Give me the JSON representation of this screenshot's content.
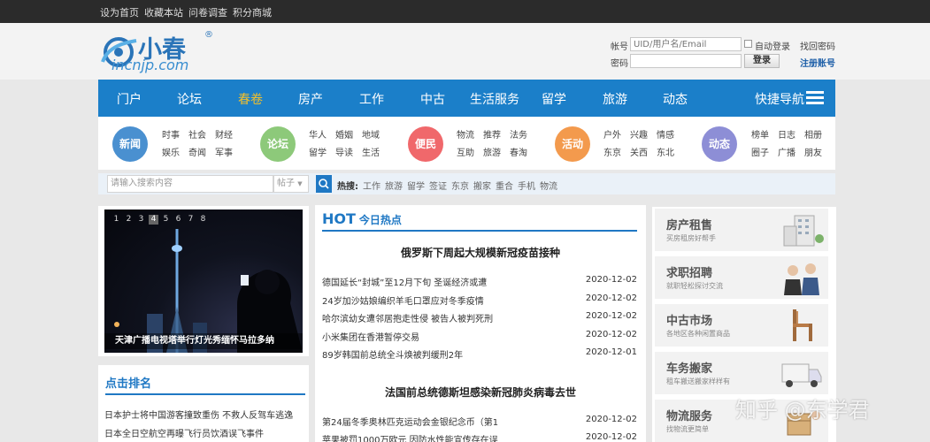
{
  "topbar": {
    "links": [
      "设为首页",
      "收藏本站",
      "问卷调查",
      "积分商城"
    ]
  },
  "logo": {
    "cn": "小春",
    "en": "incnjp.com",
    "reg": "®"
  },
  "login": {
    "account_label": "帐号",
    "account_placeholder": "UID/用户名/Email",
    "auto_login": "自动登录",
    "find_password": "找回密码",
    "password_label": "密码",
    "login_button": "登录",
    "register": "注册账号"
  },
  "nav": {
    "items": [
      "门户",
      "论坛",
      "春卷",
      "房产",
      "工作",
      "中古",
      "生活服务",
      "留学",
      "旅游",
      "动态"
    ],
    "active": "春卷",
    "quick": "快捷导航"
  },
  "categories": [
    {
      "name": "新闻",
      "color": "#4a90d0",
      "links": [
        "时事",
        "社会",
        "财经",
        "娱乐",
        "奇闻",
        "军事"
      ]
    },
    {
      "name": "论坛",
      "color": "#8dc97a",
      "links": [
        "华人",
        "婚姻",
        "地域",
        "留学",
        "导读",
        "生活"
      ]
    },
    {
      "name": "便民",
      "color": "#f0686b",
      "links": [
        "物流",
        "推荐",
        "法务",
        "互助",
        "旅游",
        "春淘"
      ]
    },
    {
      "name": "活动",
      "color": "#f39a4d",
      "links": [
        "户外",
        "兴趣",
        "情感",
        "东京",
        "关西",
        "东北"
      ]
    },
    {
      "name": "动态",
      "color": "#8d8ed6",
      "links": [
        "榜单",
        "日志",
        "相册",
        "圈子",
        "广播",
        "朋友"
      ]
    }
  ],
  "search": {
    "placeholder": "请输入搜索内容",
    "type": "帖子",
    "hot_label": "热搜:",
    "hot": [
      "工作",
      "旅游",
      "留学",
      "签证",
      "东京",
      "搬家",
      "重合",
      "手机",
      "物流"
    ]
  },
  "slider": {
    "pages": [
      "1",
      "2",
      "3",
      "4",
      "5",
      "6",
      "7",
      "8"
    ],
    "active_page": "4",
    "caption": "天津广播电视塔举行灯光秀缅怀马拉多纳"
  },
  "rank": {
    "title": "点击排名",
    "items": [
      "日本护士将中国游客撞致重伤 不救人反驾车逃逸",
      "日本全日空航空再曝飞行员饮酒误飞事件"
    ]
  },
  "hot": {
    "title": "HOT",
    "subtitle": "今日热点",
    "headline1": "俄罗斯下周起大规模新冠疫苗接种",
    "news1": [
      {
        "title": "德国延长“封城”至12月下旬 圣诞经济或遭",
        "date": "2020-12-02"
      },
      {
        "title": "24岁加沙姑娘编织羊毛口罩应对冬季疫情",
        "date": "2020-12-02"
      },
      {
        "title": "哈尔滨幼女遭邻居抱走性侵 被告人被判死刑",
        "date": "2020-12-02"
      },
      {
        "title": "小米集团在香港暂停交易",
        "date": "2020-12-02"
      },
      {
        "title": "89岁韩国前总统全斗焕被判缓刑2年",
        "date": "2020-12-01"
      }
    ],
    "headline2": "法国前总统德斯坦感染新冠肺炎病毒去世",
    "news2": [
      {
        "title": "第24届冬季奥林匹克运动会金银纪念币（第1",
        "date": "2020-12-02"
      },
      {
        "title": "苹果被罚1000万欧元 因防水性能宣传存在误",
        "date": "2020-12-02"
      }
    ]
  },
  "side": [
    {
      "title": "房产租售",
      "sub": "买房租房好帮手",
      "icon": "building-icon"
    },
    {
      "title": "求职招聘",
      "sub": "就职轻松探讨交流",
      "icon": "people-icon"
    },
    {
      "title": "中古市场",
      "sub": "各地区各种闲置商品",
      "icon": "chair-icon"
    },
    {
      "title": "车务搬家",
      "sub": "租车搬送搬家样样有",
      "icon": "truck-icon"
    },
    {
      "title": "物流服务",
      "sub": "找物流更简单",
      "icon": "box-icon"
    }
  ],
  "watermark": "知乎 @东学君"
}
